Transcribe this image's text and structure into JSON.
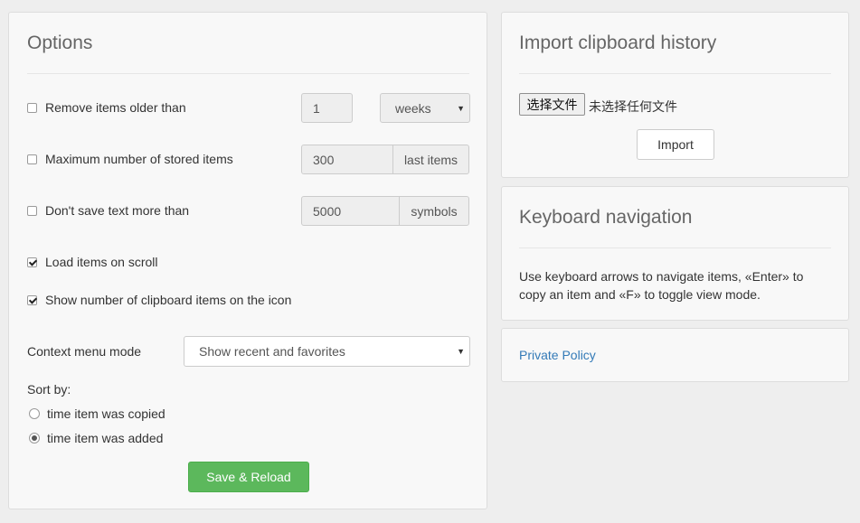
{
  "options": {
    "title": "Options",
    "remove_older": {
      "label": "Remove items older than",
      "checked": false,
      "value": "1",
      "unit": "weeks"
    },
    "max_items": {
      "label": "Maximum number of stored items",
      "checked": false,
      "value": "300",
      "addon": "last items"
    },
    "max_text": {
      "label": "Don't save text more than",
      "checked": false,
      "value": "5000",
      "addon": "symbols"
    },
    "load_on_scroll": {
      "label": "Load items on scroll",
      "checked": true
    },
    "show_count": {
      "label": "Show number of clipboard items on the icon",
      "checked": true
    },
    "context_menu": {
      "label": "Context menu mode",
      "value": "Show recent and favorites"
    },
    "sort_by": {
      "label": "Sort by:",
      "options": [
        {
          "label": "time item was copied",
          "selected": false
        },
        {
          "label": "time item was added",
          "selected": true
        }
      ]
    },
    "save_label": "Save & Reload"
  },
  "import": {
    "title": "Import clipboard history",
    "file_button": "选择文件",
    "file_status": "未选择任何文件",
    "import_label": "Import"
  },
  "keyboard": {
    "title": "Keyboard navigation",
    "line1": "Use keyboard arrows to navigate items, «Enter» to",
    "line2": "copy an item and «F» to toggle view mode."
  },
  "policy": {
    "link": "Private Policy"
  },
  "colors": {
    "link": "#337ab7",
    "success": "#5cb85c"
  }
}
